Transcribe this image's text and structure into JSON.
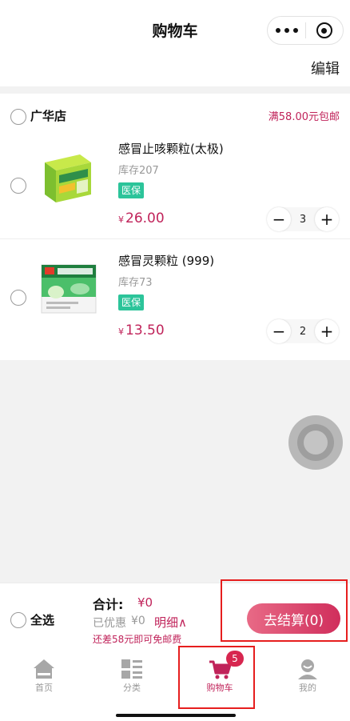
{
  "titlebar": {
    "title": "购物车",
    "more_icon": "more-dots-icon",
    "close_icon": "target-circle-icon"
  },
  "edit_label": "编辑",
  "store": {
    "name": "广华店",
    "shipping_note": "满58.00元包邮",
    "items": [
      {
        "name": "感冒止咳颗粒(太极)",
        "stock": "库存207",
        "tag": "医保",
        "currency": "¥",
        "price": "26.00",
        "qty": "3"
      },
      {
        "name": "感冒灵颗粒 (999)",
        "stock": "库存73",
        "tag": "医保",
        "currency": "¥",
        "price": "13.50",
        "qty": "2"
      }
    ]
  },
  "checkout": {
    "select_all": "全选",
    "total_label": "合计:",
    "total_value": "¥0",
    "discount_label": "已优惠",
    "discount_value": "¥0",
    "detail": "明细∧",
    "free_shipping_note": "还差58元即可免邮费",
    "pay_button": "去结算(0)"
  },
  "tabs": [
    {
      "label": "首页",
      "icon": "home-icon"
    },
    {
      "label": "分类",
      "icon": "category-icon"
    },
    {
      "label": "购物车",
      "icon": "cart-icon",
      "badge": "5",
      "active": true
    },
    {
      "label": "我的",
      "icon": "profile-icon"
    }
  ],
  "colors": {
    "accent": "#c0235a",
    "tag_green": "#2cc49a",
    "highlight_red": "#e61e1e"
  }
}
